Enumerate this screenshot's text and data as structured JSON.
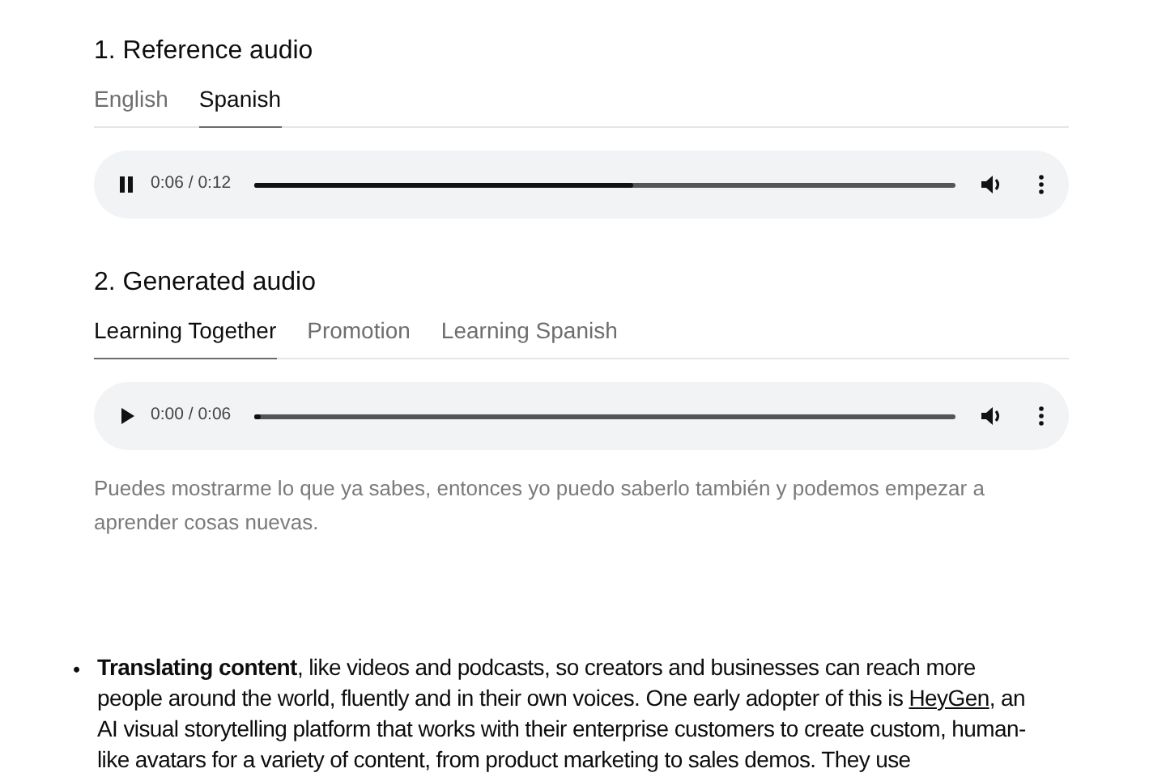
{
  "sections": [
    {
      "heading": "1. Reference audio",
      "tabs": [
        {
          "label": "English",
          "selected": false
        },
        {
          "label": "Spanish",
          "selected": true
        }
      ],
      "player": {
        "playing": true,
        "time": "0:06 / 0:12",
        "level": 0.54
      }
    },
    {
      "heading": "2. Generated audio",
      "tabs": [
        {
          "label": "Learning Together",
          "selected": true
        },
        {
          "label": "Promotion",
          "selected": false
        },
        {
          "label": "Learning Spanish",
          "selected": false
        }
      ],
      "player": {
        "playing": false,
        "time": "0:00 / 0:06",
        "level": 0.01
      },
      "caption": "Puedes mostrarme lo que ya sabes, entonces yo puedo saberlo también y podemos empezar a aprender cosas nuevas."
    }
  ],
  "bullet": {
    "marker": "•",
    "before": "**Translating content**, like videos and podcasts, so creators and businesses can reach more people around the world, fluently and in their own voices. One early adopter of this is ",
    "link": "HeyGen",
    "after": ", an AI visual storytelling platform that works with their enterprise customers to create custom, human-like avatars for a variety of content, from product marketing to sales demos. They use"
  }
}
